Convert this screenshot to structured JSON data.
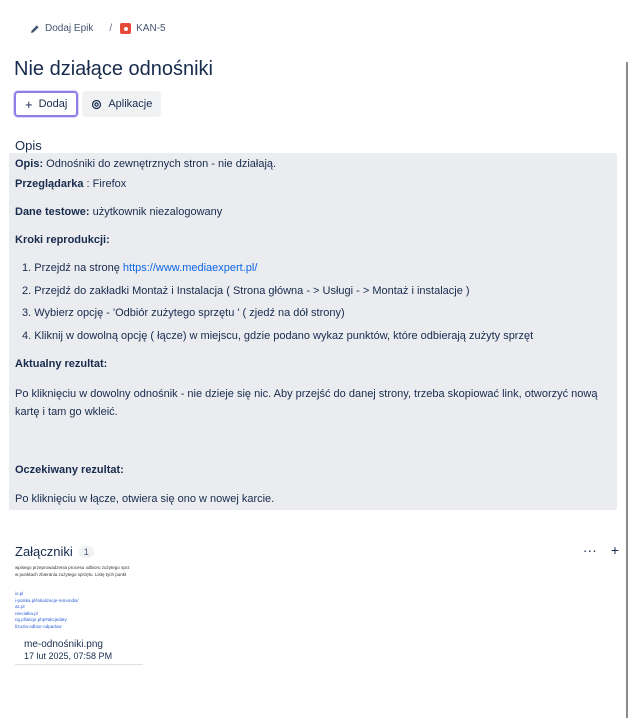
{
  "breadcrumb": {
    "epic_label": "Dodaj Epik",
    "separator": "/",
    "issue_key": "KAN-5"
  },
  "issue": {
    "title": "Nie działące odnośniki"
  },
  "toolbar": {
    "add_label": "Dodaj",
    "apps_label": "Aplikacje"
  },
  "description": {
    "section_label": "Opis",
    "opis_key": "Opis:",
    "opis_value": " Odnośniki do zewnętrznych stron - nie działają.",
    "browser_key": "Przeglądarka",
    "browser_value": " : Firefox",
    "testdata_key": "Dane testowe:",
    "testdata_value": " użytkownik niezalogowany",
    "steps_heading": "Kroki reprodukcji:",
    "steps": [
      {
        "num": "1.",
        "text": " Przejdź na stronę ",
        "link": "https://www.mediaexpert.pl/"
      },
      {
        "num": "2.",
        "text": " Przejdź do zakładki Montaż i Instalacja ( Strona główna - > Usługi - > Montaż i instalacje )"
      },
      {
        "num": "3.",
        "text": " Wybierz opcję - 'Odbiór zużytego sprzętu ' ( zjedź na dół strony)"
      },
      {
        "num": "4.",
        "text": " Kliknij w dowolną opcję ( łącze) w miejscu, gdzie podano wykaz punktów, które odbierają zużyty sprzęt"
      }
    ],
    "actual_heading": "Aktualny rezultat:",
    "actual_text": "Po kliknięciu w dowolny odnośnik - nie dzieje się nic. Aby przejść do danej strony, trzeba skopiować link, otworzyć nową kartę i tam go wkleić.",
    "expected_heading": "Oczekiwany rezultat:",
    "expected_text": "Po kliknięciu w łącze, otwiera się ono w nowej karcie."
  },
  "attachments": {
    "title": "Załączniki",
    "count": "1",
    "more_icon": "ellipsis-icon",
    "add_icon": "plus-icon",
    "thumbnail_lines": [
      "wpisego przeprowadzenia procesu odbioru zużytego sprz",
      "w punktach zbierania zużytego sprzętu. Listę tych punkt"
    ],
    "thumbnail_links": [
      "io.pl",
      "i-polska.pl/lokalizacje-remondis/",
      "az.pl",
      "reecialka.pl",
      "ng.pl/akcje.php#akcjedaty",
      "l/zuzia-odbior-odpadow"
    ],
    "file_name": "me-odnośniki.png",
    "file_date": "17 lut 2025, 07:58 PM"
  },
  "colors": {
    "accent_border": "#8f7ee7",
    "link": "#0c66e4",
    "bug_icon": "#e5493a",
    "panel_bg": "#ebecf0"
  }
}
